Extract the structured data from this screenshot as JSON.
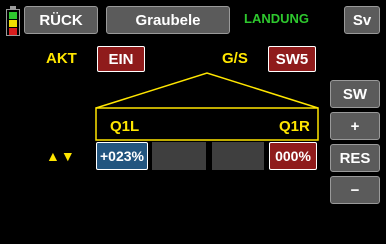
{
  "header": {
    "back_label": "RÜCK",
    "model_name": "Graubele",
    "phase_name": "LANDUNG",
    "sv_label": "Sv"
  },
  "row_akt": {
    "label": "AKT",
    "value": "EIN"
  },
  "row_gs": {
    "label": "G/S",
    "value": "SW5"
  },
  "curve": {
    "left_label": "Q1L",
    "right_label": "Q1R"
  },
  "values_row": {
    "arrows": "▲▼",
    "left_value": "+023%",
    "right_value": "000%"
  },
  "side_buttons": {
    "sw_label": "SW",
    "plus_label": "+",
    "res_label": "RES",
    "minus_label": "−"
  },
  "colors": {
    "accent_yellow": "#ffe600",
    "phase_green": "#2ec82e",
    "active_red": "#8f1b1b",
    "selected_blue": "#22557f",
    "button_gray": "#5b5b5b",
    "background": "#000000"
  },
  "icons": {
    "battery": "battery-icon"
  }
}
